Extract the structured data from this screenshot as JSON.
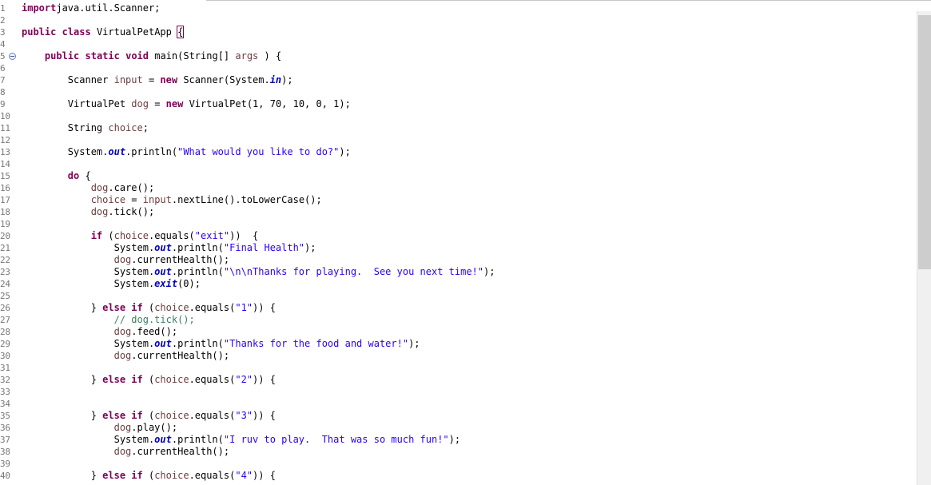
{
  "editor": {
    "lines": [
      {
        "n": "1",
        "t": [
          [
            "kw",
            "import"
          ],
          [
            "",
            "java.util.Scanner;"
          ]
        ]
      },
      {
        "n": "2",
        "t": []
      },
      {
        "n": "3",
        "t": [
          [
            "kw",
            "public"
          ],
          [
            "",
            " "
          ],
          [
            "kw",
            "class"
          ],
          [
            "",
            " VirtualPetApp "
          ],
          [
            "bracket",
            "{"
          ]
        ]
      },
      {
        "n": "4",
        "t": []
      },
      {
        "n": "5",
        "fold": true,
        "t": [
          [
            "",
            "    "
          ],
          [
            "kw",
            "public"
          ],
          [
            "",
            " "
          ],
          [
            "kw",
            "static"
          ],
          [
            "",
            " "
          ],
          [
            "kw",
            "void"
          ],
          [
            "",
            " main(String[] "
          ],
          [
            "var",
            "args"
          ],
          [
            "",
            " ) {"
          ]
        ]
      },
      {
        "n": "6",
        "t": []
      },
      {
        "n": "7",
        "t": [
          [
            "",
            "        Scanner "
          ],
          [
            "var",
            "input"
          ],
          [
            "",
            " = "
          ],
          [
            "kw",
            "new"
          ],
          [
            "",
            " Scanner(System."
          ],
          [
            "fld",
            "in"
          ],
          [
            "",
            ");"
          ]
        ]
      },
      {
        "n": "8",
        "t": []
      },
      {
        "n": "9",
        "t": [
          [
            "",
            "        VirtualPet "
          ],
          [
            "var",
            "dog"
          ],
          [
            "",
            " = "
          ],
          [
            "kw",
            "new"
          ],
          [
            "",
            " VirtualPet(1, 70, 10, 0, 1);"
          ]
        ]
      },
      {
        "n": "10",
        "t": []
      },
      {
        "n": "11",
        "t": [
          [
            "",
            "        String "
          ],
          [
            "var",
            "choice"
          ],
          [
            "",
            ";"
          ]
        ]
      },
      {
        "n": "12",
        "t": []
      },
      {
        "n": "13",
        "t": [
          [
            "",
            "        System."
          ],
          [
            "fld",
            "out"
          ],
          [
            "",
            ".println("
          ],
          [
            "str",
            "\"What would you like to do?\""
          ],
          [
            "",
            ");"
          ]
        ]
      },
      {
        "n": "14",
        "t": []
      },
      {
        "n": "15",
        "t": [
          [
            "",
            "        "
          ],
          [
            "kw",
            "do"
          ],
          [
            "",
            " {"
          ]
        ]
      },
      {
        "n": "16",
        "t": [
          [
            "",
            "            "
          ],
          [
            "var",
            "dog"
          ],
          [
            "",
            ".care();"
          ]
        ]
      },
      {
        "n": "17",
        "t": [
          [
            "",
            "            "
          ],
          [
            "var",
            "choice"
          ],
          [
            "",
            " = "
          ],
          [
            "var",
            "input"
          ],
          [
            "",
            ".nextLine().toLowerCase();"
          ]
        ]
      },
      {
        "n": "18",
        "t": [
          [
            "",
            "            "
          ],
          [
            "var",
            "dog"
          ],
          [
            "",
            ".tick();"
          ]
        ]
      },
      {
        "n": "19",
        "t": []
      },
      {
        "n": "20",
        "t": [
          [
            "",
            "            "
          ],
          [
            "kw",
            "if"
          ],
          [
            "",
            " ("
          ],
          [
            "var",
            "choice"
          ],
          [
            "",
            ".equals("
          ],
          [
            "str",
            "\"exit\""
          ],
          [
            "",
            "))  {"
          ]
        ]
      },
      {
        "n": "21",
        "t": [
          [
            "",
            "                System."
          ],
          [
            "fld",
            "out"
          ],
          [
            "",
            ".println("
          ],
          [
            "str",
            "\"Final Health\""
          ],
          [
            "",
            ");"
          ]
        ]
      },
      {
        "n": "22",
        "t": [
          [
            "",
            "                "
          ],
          [
            "var",
            "dog"
          ],
          [
            "",
            ".currentHealth();"
          ]
        ]
      },
      {
        "n": "23",
        "t": [
          [
            "",
            "                System."
          ],
          [
            "fld",
            "out"
          ],
          [
            "",
            ".println("
          ],
          [
            "str",
            "\"\\n\\nThanks for playing.  See you next time!\""
          ],
          [
            "",
            ");"
          ]
        ]
      },
      {
        "n": "24",
        "t": [
          [
            "",
            "                System."
          ],
          [
            "fld",
            "exit"
          ],
          [
            "",
            "(0);"
          ]
        ]
      },
      {
        "n": "25",
        "t": []
      },
      {
        "n": "26",
        "t": [
          [
            "",
            "            } "
          ],
          [
            "kw",
            "else"
          ],
          [
            "",
            " "
          ],
          [
            "kw",
            "if"
          ],
          [
            "",
            " ("
          ],
          [
            "var",
            "choice"
          ],
          [
            "",
            ".equals("
          ],
          [
            "str",
            "\"1\""
          ],
          [
            "",
            ")) {"
          ]
        ]
      },
      {
        "n": "27",
        "t": [
          [
            "cmt",
            "                // dog.tick();"
          ]
        ]
      },
      {
        "n": "28",
        "t": [
          [
            "",
            "                "
          ],
          [
            "var",
            "dog"
          ],
          [
            "",
            ".feed();"
          ]
        ]
      },
      {
        "n": "29",
        "t": [
          [
            "",
            "                System."
          ],
          [
            "fld",
            "out"
          ],
          [
            "",
            ".println("
          ],
          [
            "str",
            "\"Thanks for the food and water!\""
          ],
          [
            "",
            ");"
          ]
        ]
      },
      {
        "n": "30",
        "t": [
          [
            "",
            "                "
          ],
          [
            "var",
            "dog"
          ],
          [
            "",
            ".currentHealth();"
          ]
        ]
      },
      {
        "n": "31",
        "t": []
      },
      {
        "n": "32",
        "t": [
          [
            "",
            "            } "
          ],
          [
            "kw",
            "else"
          ],
          [
            "",
            " "
          ],
          [
            "kw",
            "if"
          ],
          [
            "",
            " ("
          ],
          [
            "var",
            "choice"
          ],
          [
            "",
            ".equals("
          ],
          [
            "str",
            "\"2\""
          ],
          [
            "",
            ")) {"
          ]
        ]
      },
      {
        "n": "33",
        "t": []
      },
      {
        "n": "34",
        "t": []
      },
      {
        "n": "35",
        "t": [
          [
            "",
            "            } "
          ],
          [
            "kw",
            "else"
          ],
          [
            "",
            " "
          ],
          [
            "kw",
            "if"
          ],
          [
            "",
            " ("
          ],
          [
            "var",
            "choice"
          ],
          [
            "",
            ".equals("
          ],
          [
            "str",
            "\"3\""
          ],
          [
            "",
            ")) {"
          ]
        ]
      },
      {
        "n": "36",
        "t": [
          [
            "",
            "                "
          ],
          [
            "var",
            "dog"
          ],
          [
            "",
            ".play();"
          ]
        ]
      },
      {
        "n": "37",
        "t": [
          [
            "",
            "                System."
          ],
          [
            "fld",
            "out"
          ],
          [
            "",
            ".println("
          ],
          [
            "str",
            "\"I ruv to play.  That was so much fun!\""
          ],
          [
            "",
            ");"
          ]
        ]
      },
      {
        "n": "38",
        "t": [
          [
            "",
            "                "
          ],
          [
            "var",
            "dog"
          ],
          [
            "",
            ".currentHealth();"
          ]
        ]
      },
      {
        "n": "39",
        "t": []
      },
      {
        "n": "40",
        "t": [
          [
            "",
            "            } "
          ],
          [
            "kw",
            "else"
          ],
          [
            "",
            " "
          ],
          [
            "kw",
            "if"
          ],
          [
            "",
            " ("
          ],
          [
            "var",
            "choice"
          ],
          [
            "",
            ".equals("
          ],
          [
            "str",
            "\"4\""
          ],
          [
            "",
            ")) {"
          ]
        ]
      }
    ]
  },
  "icons": {
    "fold": "collapse-minus-icon"
  },
  "colors": {
    "keyword": "#7f0055",
    "string": "#2a00ff",
    "field": "#0000c0",
    "variable": "#6a3e3e",
    "comment": "#3f7f5f",
    "line_number": "#787878"
  }
}
